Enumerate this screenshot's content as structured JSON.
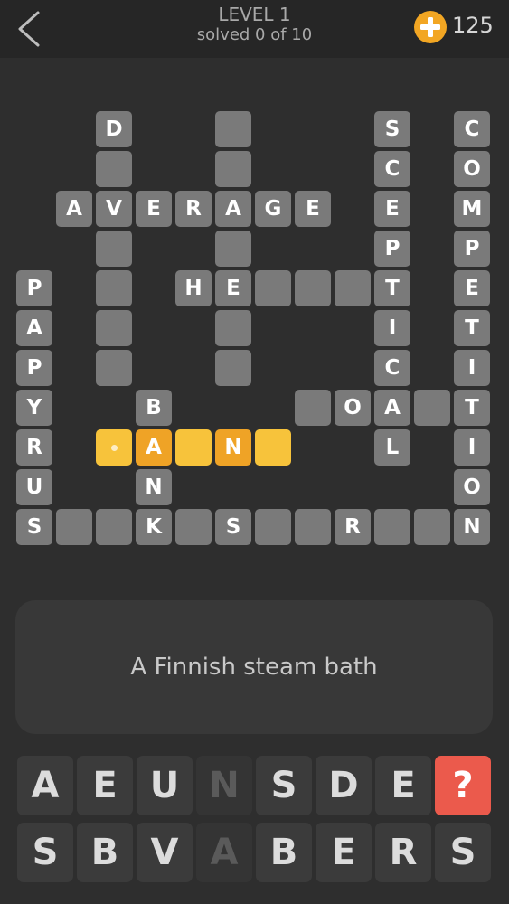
{
  "header": {
    "level": "LEVEL 1",
    "progress": "solved 0 of 10",
    "coins": "125"
  },
  "grid": {
    "cells": [
      {
        "id": "r0c2",
        "r": 0,
        "c": 2,
        "letter": "D"
      },
      {
        "id": "r0c5",
        "r": 0,
        "c": 5,
        "letter": ""
      },
      {
        "id": "r0c9",
        "r": 0,
        "c": 9,
        "letter": "S"
      },
      {
        "id": "r0c11",
        "r": 0,
        "c": 11,
        "letter": "C"
      },
      {
        "id": "r1c2",
        "r": 1,
        "c": 2,
        "letter": ""
      },
      {
        "id": "r1c5",
        "r": 1,
        "c": 5,
        "letter": ""
      },
      {
        "id": "r1c9",
        "r": 1,
        "c": 9,
        "letter": "C"
      },
      {
        "id": "r1c11",
        "r": 1,
        "c": 11,
        "letter": "O"
      },
      {
        "id": "r2c1",
        "r": 2,
        "c": 1,
        "letter": "A"
      },
      {
        "id": "r2c2",
        "r": 2,
        "c": 2,
        "letter": "V"
      },
      {
        "id": "r2c3",
        "r": 2,
        "c": 3,
        "letter": "E"
      },
      {
        "id": "r2c4",
        "r": 2,
        "c": 4,
        "letter": "R"
      },
      {
        "id": "r2c5",
        "r": 2,
        "c": 5,
        "letter": "A"
      },
      {
        "id": "r2c6",
        "r": 2,
        "c": 6,
        "letter": "G"
      },
      {
        "id": "r2c7",
        "r": 2,
        "c": 7,
        "letter": "E"
      },
      {
        "id": "r2c9",
        "r": 2,
        "c": 9,
        "letter": "E"
      },
      {
        "id": "r2c11",
        "r": 2,
        "c": 11,
        "letter": "M"
      },
      {
        "id": "r3c2",
        "r": 3,
        "c": 2,
        "letter": ""
      },
      {
        "id": "r3c5",
        "r": 3,
        "c": 5,
        "letter": ""
      },
      {
        "id": "r3c9",
        "r": 3,
        "c": 9,
        "letter": "P"
      },
      {
        "id": "r3c11",
        "r": 3,
        "c": 11,
        "letter": "P"
      },
      {
        "id": "r4c0",
        "r": 4,
        "c": 0,
        "letter": "P"
      },
      {
        "id": "r4c2",
        "r": 4,
        "c": 2,
        "letter": ""
      },
      {
        "id": "r4c4",
        "r": 4,
        "c": 4,
        "letter": "H"
      },
      {
        "id": "r4c5",
        "r": 4,
        "c": 5,
        "letter": "E"
      },
      {
        "id": "r4c6",
        "r": 4,
        "c": 6,
        "letter": ""
      },
      {
        "id": "r4c7",
        "r": 4,
        "c": 7,
        "letter": ""
      },
      {
        "id": "r4c8",
        "r": 4,
        "c": 8,
        "letter": ""
      },
      {
        "id": "r4c9",
        "r": 4,
        "c": 9,
        "letter": "T"
      },
      {
        "id": "r4c11",
        "r": 4,
        "c": 11,
        "letter": "E"
      },
      {
        "id": "r5c0",
        "r": 5,
        "c": 0,
        "letter": "A"
      },
      {
        "id": "r5c2",
        "r": 5,
        "c": 2,
        "letter": ""
      },
      {
        "id": "r5c5",
        "r": 5,
        "c": 5,
        "letter": ""
      },
      {
        "id": "r5c9",
        "r": 5,
        "c": 9,
        "letter": "I"
      },
      {
        "id": "r5c11",
        "r": 5,
        "c": 11,
        "letter": "T"
      },
      {
        "id": "r6c0",
        "r": 6,
        "c": 0,
        "letter": "P"
      },
      {
        "id": "r6c2",
        "r": 6,
        "c": 2,
        "letter": ""
      },
      {
        "id": "r6c5",
        "r": 6,
        "c": 5,
        "letter": ""
      },
      {
        "id": "r6c9",
        "r": 6,
        "c": 9,
        "letter": "C"
      },
      {
        "id": "r6c11",
        "r": 6,
        "c": 11,
        "letter": "I"
      },
      {
        "id": "r7c0",
        "r": 7,
        "c": 0,
        "letter": "Y"
      },
      {
        "id": "r7c3",
        "r": 7,
        "c": 3,
        "letter": "B"
      },
      {
        "id": "r7c7",
        "r": 7,
        "c": 7,
        "letter": ""
      },
      {
        "id": "r7c8",
        "r": 7,
        "c": 8,
        "letter": "O"
      },
      {
        "id": "r7c9",
        "r": 7,
        "c": 9,
        "letter": "A"
      },
      {
        "id": "r7c10",
        "r": 7,
        "c": 10,
        "letter": ""
      },
      {
        "id": "r7c11",
        "r": 7,
        "c": 11,
        "letter": "T"
      },
      {
        "id": "r8c0",
        "r": 8,
        "c": 0,
        "letter": "R"
      },
      {
        "id": "r8c2",
        "r": 8,
        "c": 2,
        "letter": "",
        "state": "hl",
        "cursor": true
      },
      {
        "id": "r8c3",
        "r": 8,
        "c": 3,
        "letter": "A",
        "state": "hl-dark"
      },
      {
        "id": "r8c4",
        "r": 8,
        "c": 4,
        "letter": "",
        "state": "hl"
      },
      {
        "id": "r8c5",
        "r": 8,
        "c": 5,
        "letter": "N",
        "state": "hl-dark"
      },
      {
        "id": "r8c6",
        "r": 8,
        "c": 6,
        "letter": "",
        "state": "hl"
      },
      {
        "id": "r8c9",
        "r": 8,
        "c": 9,
        "letter": "L"
      },
      {
        "id": "r8c11",
        "r": 8,
        "c": 11,
        "letter": "I"
      },
      {
        "id": "r9c0",
        "r": 9,
        "c": 0,
        "letter": "U"
      },
      {
        "id": "r9c3",
        "r": 9,
        "c": 3,
        "letter": "N"
      },
      {
        "id": "r9c11",
        "r": 9,
        "c": 11,
        "letter": "O"
      },
      {
        "id": "r10c0",
        "r": 10,
        "c": 0,
        "letter": "S"
      },
      {
        "id": "r10c1",
        "r": 10,
        "c": 1,
        "letter": ""
      },
      {
        "id": "r10c2",
        "r": 10,
        "c": 2,
        "letter": ""
      },
      {
        "id": "r10c3",
        "r": 10,
        "c": 3,
        "letter": "K"
      },
      {
        "id": "r10c4",
        "r": 10,
        "c": 4,
        "letter": ""
      },
      {
        "id": "r10c5",
        "r": 10,
        "c": 5,
        "letter": "S"
      },
      {
        "id": "r10c6",
        "r": 10,
        "c": 6,
        "letter": ""
      },
      {
        "id": "r10c7",
        "r": 10,
        "c": 7,
        "letter": ""
      },
      {
        "id": "r10c8",
        "r": 10,
        "c": 8,
        "letter": "R"
      },
      {
        "id": "r10c9",
        "r": 10,
        "c": 9,
        "letter": ""
      },
      {
        "id": "r10c10",
        "r": 10,
        "c": 10,
        "letter": ""
      },
      {
        "id": "r10c11",
        "r": 10,
        "c": 11,
        "letter": "N"
      }
    ]
  },
  "clue": {
    "text": "A Finnish steam bath"
  },
  "keyboard": {
    "row1": [
      {
        "letter": "A",
        "state": "normal"
      },
      {
        "letter": "E",
        "state": "normal"
      },
      {
        "letter": "U",
        "state": "normal"
      },
      {
        "letter": "N",
        "state": "used"
      },
      {
        "letter": "S",
        "state": "normal"
      },
      {
        "letter": "D",
        "state": "normal"
      },
      {
        "letter": "E",
        "state": "normal"
      },
      {
        "letter": "?",
        "state": "hint"
      }
    ],
    "row2": [
      {
        "letter": "S",
        "state": "normal"
      },
      {
        "letter": "B",
        "state": "normal"
      },
      {
        "letter": "V",
        "state": "normal"
      },
      {
        "letter": "A",
        "state": "used"
      },
      {
        "letter": "B",
        "state": "normal"
      },
      {
        "letter": "E",
        "state": "normal"
      },
      {
        "letter": "R",
        "state": "normal"
      },
      {
        "letter": "S",
        "state": "normal"
      }
    ]
  },
  "colors": {
    "accent": "#f2a623",
    "hint": "#eb5a4c",
    "highlight": "#f7c33b",
    "highlight_filled": "#efa326"
  }
}
